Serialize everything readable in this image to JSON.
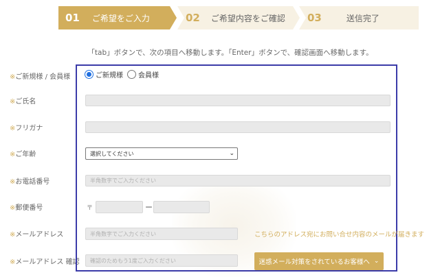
{
  "steps": [
    {
      "num": "01",
      "label": "ご希望をご入力"
    },
    {
      "num": "02",
      "label": "ご希望内容をご確認"
    },
    {
      "num": "03",
      "label": "送信完了"
    }
  ],
  "instruction": "「tab」ボタンで、次の項目へ移動します。「Enter」ボタンで、確認画面へ移動します。",
  "required_mark": "※",
  "form": {
    "customer_type": {
      "label": "ご新規様 / 会員様",
      "options": [
        "ご新規様",
        "会員様"
      ],
      "selected": "ご新規様"
    },
    "name": {
      "label": "ご氏名"
    },
    "furigana": {
      "label": "フリガナ"
    },
    "age": {
      "label": "ご年齢",
      "value": "選択してください"
    },
    "phone": {
      "label": "お電話番号",
      "placeholder": "半角数字でご入力ください"
    },
    "postal": {
      "label": "郵便番号",
      "mark": "〒",
      "separator": "ー"
    },
    "email": {
      "label": "メールアドレス",
      "placeholder": "半角数字でご入力ください"
    },
    "email_confirm": {
      "label": "メールアドレス 確認",
      "placeholder": "確認のためもう1度ご入力ください"
    }
  },
  "mail_note": "こちらのアドレス宛にお問い合せ内容のメールが届きます",
  "spam_button": "迷惑メール対策をされているお客様へ"
}
